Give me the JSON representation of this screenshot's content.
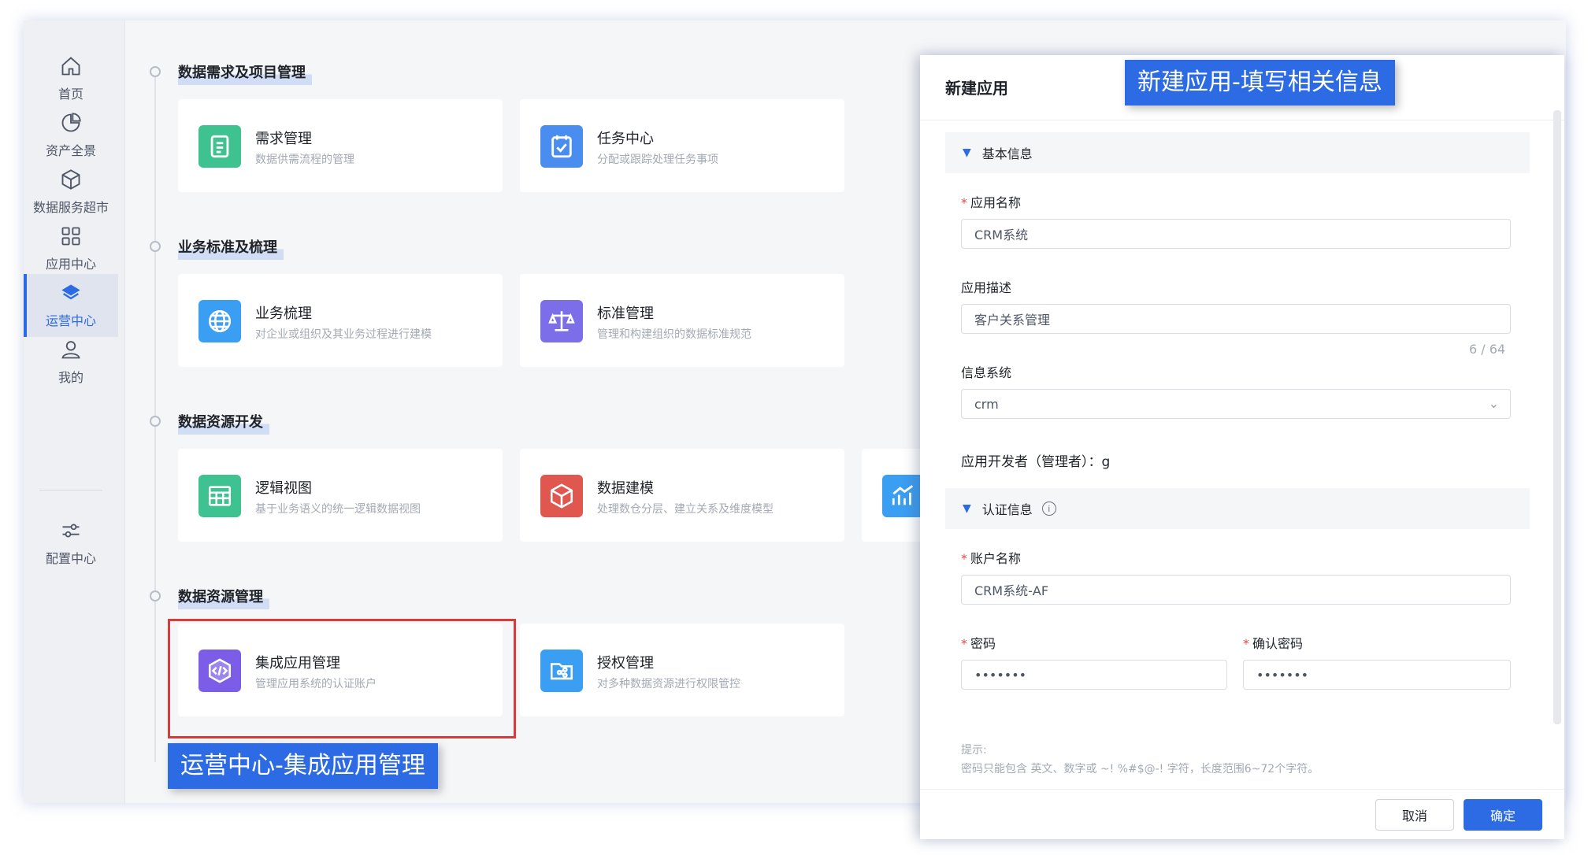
{
  "sidebar": {
    "items": [
      {
        "label": "首页",
        "icon": "home-icon"
      },
      {
        "label": "资产全景",
        "icon": "pie-chart-icon"
      },
      {
        "label": "数据服务超市",
        "icon": "cube-icon"
      },
      {
        "label": "应用中心",
        "icon": "grid-icon"
      },
      {
        "label": "运营中心",
        "icon": "layers-icon",
        "active": true
      },
      {
        "label": "我的",
        "icon": "user-icon"
      },
      {
        "label": "配置中心",
        "icon": "sliders-icon"
      }
    ]
  },
  "sections": [
    {
      "title": "数据需求及项目管理",
      "cards": [
        {
          "title": "需求管理",
          "desc": "数据供需流程的管理",
          "icon": "document-list-icon",
          "color": "#3ec28f"
        },
        {
          "title": "任务中心",
          "desc": "分配或跟踪处理任务事项",
          "icon": "task-check-icon",
          "color": "#4a8df0"
        }
      ]
    },
    {
      "title": "业务标准及梳理",
      "cards": [
        {
          "title": "业务梳理",
          "desc": "对企业或组织及其业务过程进行建模",
          "icon": "globe-icon",
          "color": "#3a9ef2"
        },
        {
          "title": "标准管理",
          "desc": "管理和构建组织的数据标准规范",
          "icon": "balance-scale-icon",
          "color": "#7b6ee8"
        }
      ]
    },
    {
      "title": "数据资源开发",
      "cards": [
        {
          "title": "逻辑视图",
          "desc": "基于业务语义的统一逻辑数据视图",
          "icon": "table-view-icon",
          "color": "#3ec28f"
        },
        {
          "title": "数据建模",
          "desc": "处理数仓分层、建立关系及维度模型",
          "icon": "model-cube-icon",
          "color": "#e0574f"
        },
        {
          "title": "",
          "desc": "",
          "icon": "trend-chart-icon",
          "color": "#3a9ef2"
        }
      ]
    },
    {
      "title": "数据资源管理",
      "cards": [
        {
          "title": "集成应用管理",
          "desc": "管理应用系统的认证账户",
          "icon": "code-app-icon",
          "color": "#7b5de8"
        },
        {
          "title": "授权管理",
          "desc": "对多种数据资源进行权限管控",
          "icon": "share-folder-icon",
          "color": "#3a9ef2"
        }
      ]
    }
  ],
  "annotations": {
    "left_banner": "运营中心-集成应用管理",
    "right_banner": "新建应用-填写相关信息",
    "highlight_color": "#d83b3b",
    "banner_color": "#2d6be4"
  },
  "panel": {
    "title": "新建应用",
    "basic_group": "基本信息",
    "app_name_label": "应用名称",
    "app_name_value": "CRM系统",
    "app_desc_label": "应用描述",
    "app_desc_value": "客户关系管理",
    "desc_counter": "6 / 64",
    "info_system_label": "信息系统",
    "info_system_value": "crm",
    "developer_text": "应用开发者（管理者）：g",
    "auth_group": "认证信息",
    "account_label": "账户名称",
    "account_value": "CRM系统-AF",
    "password_label": "密码",
    "password_value": "•••••••",
    "confirm_label": "确认密码",
    "confirm_value": "•••••••",
    "tip_title": "提示:",
    "tip_line1": "密码只能包含 英文、数字或 ~! %#$@-! 字符，长度范围6~72个字符。",
    "cancel_label": "取消",
    "ok_label": "确定"
  }
}
